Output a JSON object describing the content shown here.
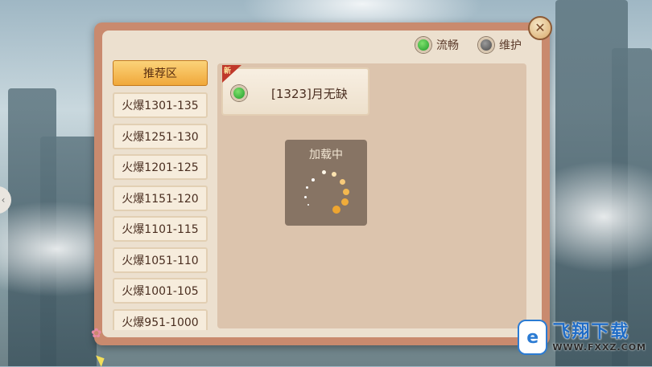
{
  "legend": {
    "smooth_label": "流畅",
    "maintenance_label": "维护"
  },
  "sidebar": {
    "items": [
      {
        "label": "推荐区",
        "active": true
      },
      {
        "label": "火爆1301-135",
        "active": false
      },
      {
        "label": "火爆1251-130",
        "active": false
      },
      {
        "label": "火爆1201-125",
        "active": false
      },
      {
        "label": "火爆1151-120",
        "active": false
      },
      {
        "label": "火爆1101-115",
        "active": false
      },
      {
        "label": "火爆1051-110",
        "active": false
      },
      {
        "label": "火爆1001-105",
        "active": false
      },
      {
        "label": "火爆951-1000",
        "active": false
      }
    ]
  },
  "servers": [
    {
      "name": "[1323]月无缺",
      "status": "smooth",
      "new": true,
      "new_tag": "新"
    }
  ],
  "loading": {
    "text": "加载中"
  },
  "watermark": {
    "logo": "e",
    "title": "飞翔下载",
    "url": "WWW.FXXZ.COM"
  },
  "icons": {
    "close": "close-icon",
    "blossom": "blossom-icon"
  },
  "colors": {
    "dialog_border": "#c98a6e",
    "panel_bg": "#ece0cf",
    "active_tab": "#f0a83a",
    "status_smooth": "#1e9b2a",
    "status_maintenance": "#4a4a4a"
  }
}
